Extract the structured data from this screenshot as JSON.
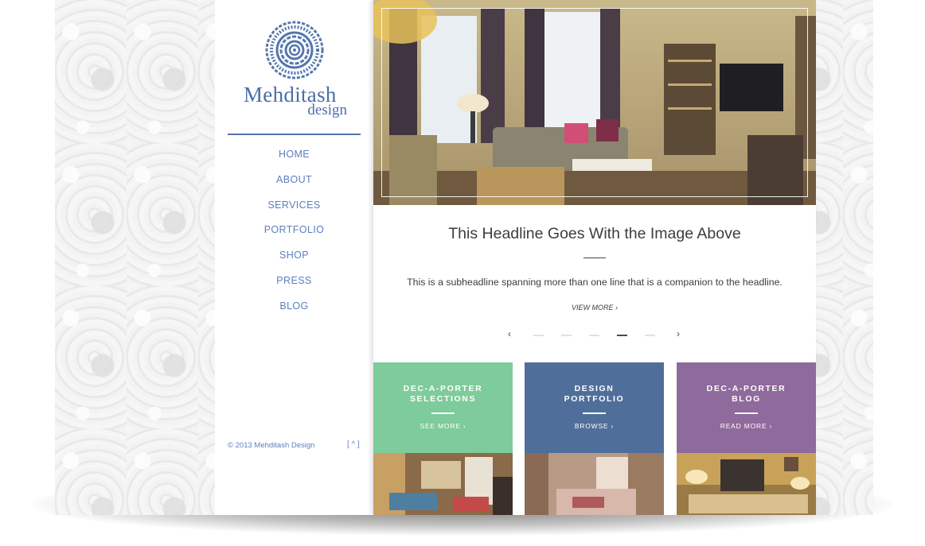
{
  "brand": {
    "name": "Mehditash",
    "sub": "design"
  },
  "nav": {
    "items": [
      "HOME",
      "ABOUT",
      "SERVICES",
      "PORTFOLIO",
      "SHOP",
      "PRESS",
      "BLOG"
    ]
  },
  "footer": {
    "copyright": "© 2013 Mehditash Design",
    "top_label": "[ ^ ]"
  },
  "hero": {
    "headline": "This Headline Goes With the Image Above",
    "subheadline": "This is a subheadline spanning more than one line that is a companion to the headline.",
    "view_more": "VIEW MORE ›",
    "prev": "‹",
    "next": "›",
    "slide_count": 5,
    "active_slide": 4
  },
  "tiles": [
    {
      "line1": "DEC-A-PORTER",
      "line2": "SELECTIONS",
      "link": "SEE MORE ›",
      "color": "#7ecb9b"
    },
    {
      "line1": "DESIGN",
      "line2": "PORTFOLIO",
      "link": "BROWSE ›",
      "color": "#4f6f9a"
    },
    {
      "line1": "DEC-A-PORTER",
      "line2": "BLOG",
      "link": "READ MORE ›",
      "color": "#8f6a9c"
    }
  ],
  "colors": {
    "brand_blue": "#4b6ea8",
    "nav_blue": "#5b7fbf",
    "text_dark": "#3d3d3d"
  }
}
